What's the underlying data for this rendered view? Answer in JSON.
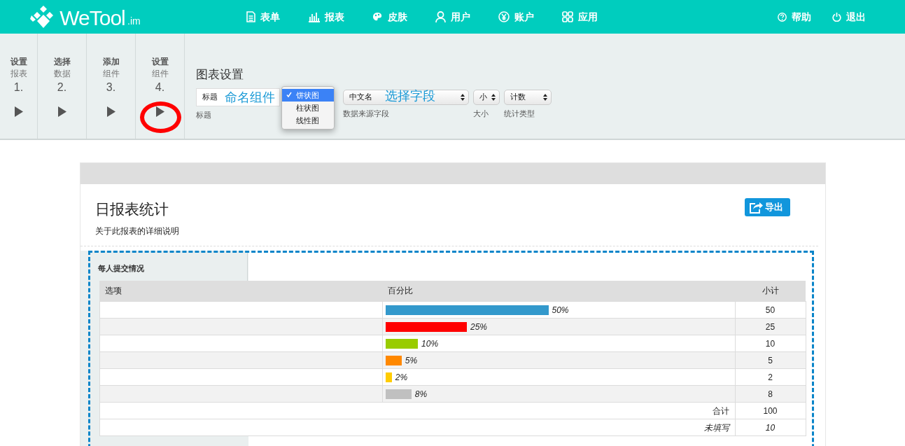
{
  "brand": {
    "name": "WeTool",
    "suffix": ".im"
  },
  "nav": {
    "items": [
      {
        "label": "表单"
      },
      {
        "label": "报表"
      },
      {
        "label": "皮肤"
      },
      {
        "label": "用户"
      },
      {
        "label": "账户"
      },
      {
        "label": "应用"
      }
    ],
    "right_items": [
      {
        "label": "帮助"
      },
      {
        "label": "退出"
      }
    ]
  },
  "steps": [
    {
      "title": "设置",
      "subtitle": "报表",
      "number": "1.",
      "circled": false
    },
    {
      "title": "选择",
      "subtitle": "数据",
      "number": "2.",
      "circled": false
    },
    {
      "title": "添加",
      "subtitle": "组件",
      "number": "3.",
      "circled": false
    },
    {
      "title": "设置",
      "subtitle": "组件",
      "number": "4.",
      "circled": true
    }
  ],
  "chart_settings": {
    "heading": "图表设置",
    "fields": [
      {
        "kind": "input",
        "value": "标题",
        "label": "标题",
        "annotation": "命名组件"
      },
      {
        "kind": "dropdown",
        "options": [
          {
            "label": "饼状图",
            "selected": true
          },
          {
            "label": "柱状图",
            "selected": false
          },
          {
            "label": "线性图",
            "selected": false
          }
        ]
      },
      {
        "kind": "select",
        "value": "中文名",
        "label": "数据来源字段",
        "annotation": "选择字段"
      },
      {
        "kind": "select",
        "value": "小",
        "label": "大小"
      },
      {
        "kind": "select",
        "value": "计数",
        "label": "统计类型"
      }
    ]
  },
  "report": {
    "title": "日报表统计",
    "description": "关于此报表的详细说明",
    "export_button": "导出",
    "component": {
      "tab": "每人提交情况",
      "columns": [
        "选项",
        "百分比",
        "小计"
      ],
      "rows": [
        {
          "percent": "50%",
          "level": 0.5,
          "color": "#3399cc",
          "subtotal": "50"
        },
        {
          "percent": "25%",
          "level": 0.25,
          "color": "#ff0000",
          "subtotal": "25"
        },
        {
          "percent": "10%",
          "level": 0.1,
          "color": "#99cc00",
          "subtotal": "10"
        },
        {
          "percent": "5%",
          "level": 0.05,
          "color": "#ff8800",
          "subtotal": "5"
        },
        {
          "percent": "2%",
          "level": 0.02,
          "color": "#ffcc00",
          "subtotal": "2"
        },
        {
          "percent": "8%",
          "level": 0.08,
          "color": "#c0c0c0",
          "subtotal": "8"
        }
      ],
      "total_label": "合计",
      "total": "100",
      "blank_label": "未填写",
      "blank": "10"
    }
  }
}
